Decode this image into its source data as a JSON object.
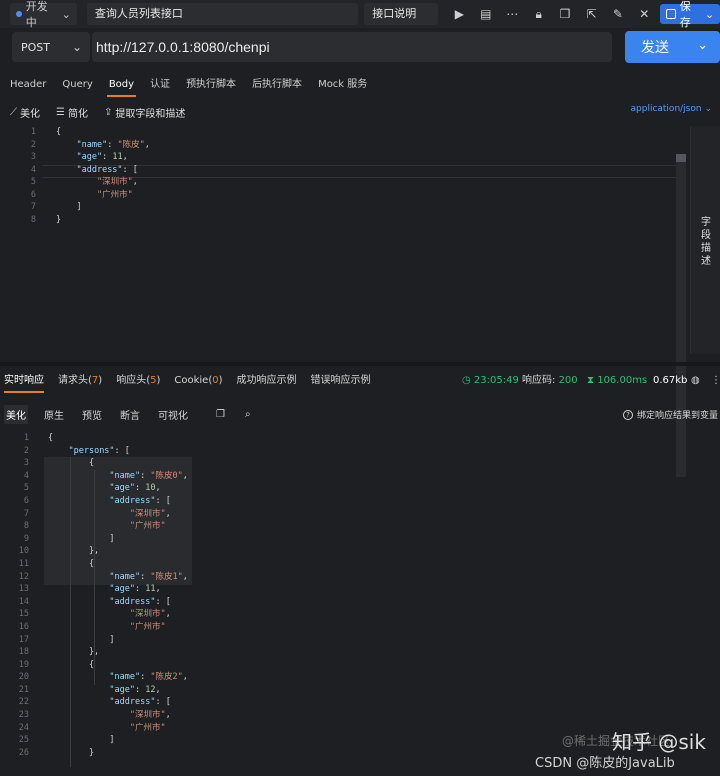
{
  "topbar": {
    "env": "开发中",
    "title": "查询人员列表接口",
    "desc_button": "接口说明",
    "save": "保存"
  },
  "request": {
    "method": "POST",
    "url": "http://127.0.0.1:8080/chenpi",
    "send": "发送",
    "tabs": [
      "Header",
      "Query",
      "Body",
      "认证",
      "预执行脚本",
      "后执行脚本",
      "Mock 服务"
    ],
    "tools": {
      "beautify": "美化",
      "simplify": "简化",
      "extract": "提取字段和描述"
    },
    "content_type": "application/json",
    "side_label": "字段描述",
    "line_numbers": [
      "1",
      "2",
      "3",
      "4",
      "5",
      "6",
      "7",
      "8"
    ],
    "body_lines": [
      "{",
      "    \"name\": \"陈皮\",",
      "    \"age\": 11,",
      "    \"address\": [",
      "        \"深圳市\",",
      "        \"广州市\"",
      "    ]",
      "}"
    ]
  },
  "response": {
    "tabs": [
      {
        "label": "实时响应",
        "count": ""
      },
      {
        "label": "请求头",
        "count": "7"
      },
      {
        "label": "响应头",
        "count": "5"
      },
      {
        "label": "Cookie",
        "count": "0"
      },
      {
        "label": "成功响应示例",
        "count": ""
      },
      {
        "label": "错误响应示例",
        "count": ""
      }
    ],
    "time": "23:05:49",
    "status_label": "响应码:",
    "status": "200",
    "duration": "106.00ms",
    "size": "0.67kb",
    "view_tabs": [
      "美化",
      "原生",
      "预览",
      "断言",
      "可视化"
    ],
    "bind_text": "绑定响应结果到变量",
    "line_numbers": [
      "1",
      "2",
      "3",
      "4",
      "5",
      "6",
      "7",
      "8",
      "9",
      "10",
      "11",
      "12",
      "13",
      "14",
      "15",
      "16",
      "17",
      "18",
      "19",
      "20",
      "21",
      "22",
      "23",
      "24",
      "25",
      "26"
    ],
    "body_lines": [
      "{",
      "    \"persons\": [",
      "        {",
      "            \"name\": \"陈皮0\",",
      "            \"age\": 10,",
      "            \"address\": [",
      "                \"深圳市\",",
      "                \"广州市\"",
      "            ]",
      "        },",
      "        {",
      "            \"name\": \"陈皮1\",",
      "            \"age\": 11,",
      "            \"address\": [",
      "                \"深圳市\",",
      "                \"广州市\"",
      "            ]",
      "        },",
      "        {",
      "            \"name\": \"陈皮2\",",
      "            \"age\": 12,",
      "            \"address\": [",
      "                \"深圳市\",",
      "                \"广州市\"",
      "            ]",
      "        }"
    ]
  },
  "watermark": {
    "juejin": "@稀土掘金技术社区",
    "zhihu": "知乎 @sik",
    "csdn": "CSDN @陈皮的JavaLib"
  }
}
